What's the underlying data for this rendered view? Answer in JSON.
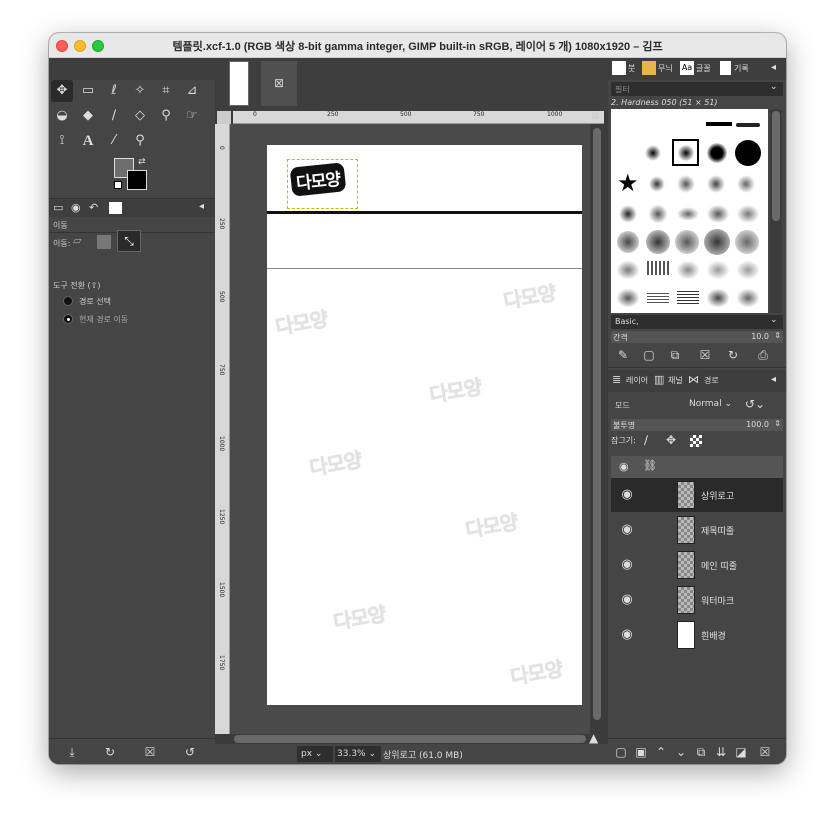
{
  "window": {
    "title": "템플릿.xcf-1.0 (RGB 색상 8-bit gamma integer, GIMP built-in sRGB, 레이어 5 개) 1080x1920 – 김프"
  },
  "toolbox": {
    "tool_options_tab_icons": [
      "tool-options-icon",
      "device-status-icon",
      "undo-history-icon",
      "images-icon"
    ],
    "move_label": "이동",
    "move_mode_label": "이동:",
    "tool_toggle_label": "도구 전환 (⇧)",
    "radio_pick": "경로 선택",
    "radio_move_active": "현재 경로 이동"
  },
  "canvas": {
    "ruler_labels": [
      "0",
      "250",
      "500",
      "750",
      "1000"
    ],
    "vruler_labels": [
      "0",
      "250",
      "500",
      "750",
      "1000",
      "1250",
      "1500",
      "1750"
    ],
    "logo_text": "다모양",
    "watermark_text": "다모양",
    "units": "px",
    "zoom": "33.3%",
    "status": "상위로고 (61.0 MB)"
  },
  "brushes": {
    "tab_brush": "붓",
    "tab_pattern": "무늬",
    "tab_font": "글꼴",
    "tab_history": "기록",
    "filter_placeholder": "필터",
    "brush_name": "2. Hardness 050 (51 × 51)",
    "tag_value": "Basic,",
    "spacing_label": "간격",
    "spacing_value": "10.0"
  },
  "layers": {
    "tab_layers": "레이어",
    "tab_channels": "채널",
    "tab_paths": "경로",
    "mode_label": "모드",
    "mode_value": "Normal",
    "opacity_label": "불투명",
    "opacity_value": "100.0",
    "lock_label": "잠그기:",
    "items": [
      {
        "name": "상위로고",
        "white": false
      },
      {
        "name": "제목띠줄",
        "white": false
      },
      {
        "name": "메인 띠줄",
        "white": false
      },
      {
        "name": "워터마크",
        "white": false
      },
      {
        "name": "흰배경",
        "white": true
      }
    ]
  },
  "colors": {
    "window_bg": "#454545",
    "canvas_bg": "#4a4a4a",
    "accent_selection": "#2a2a2a"
  }
}
